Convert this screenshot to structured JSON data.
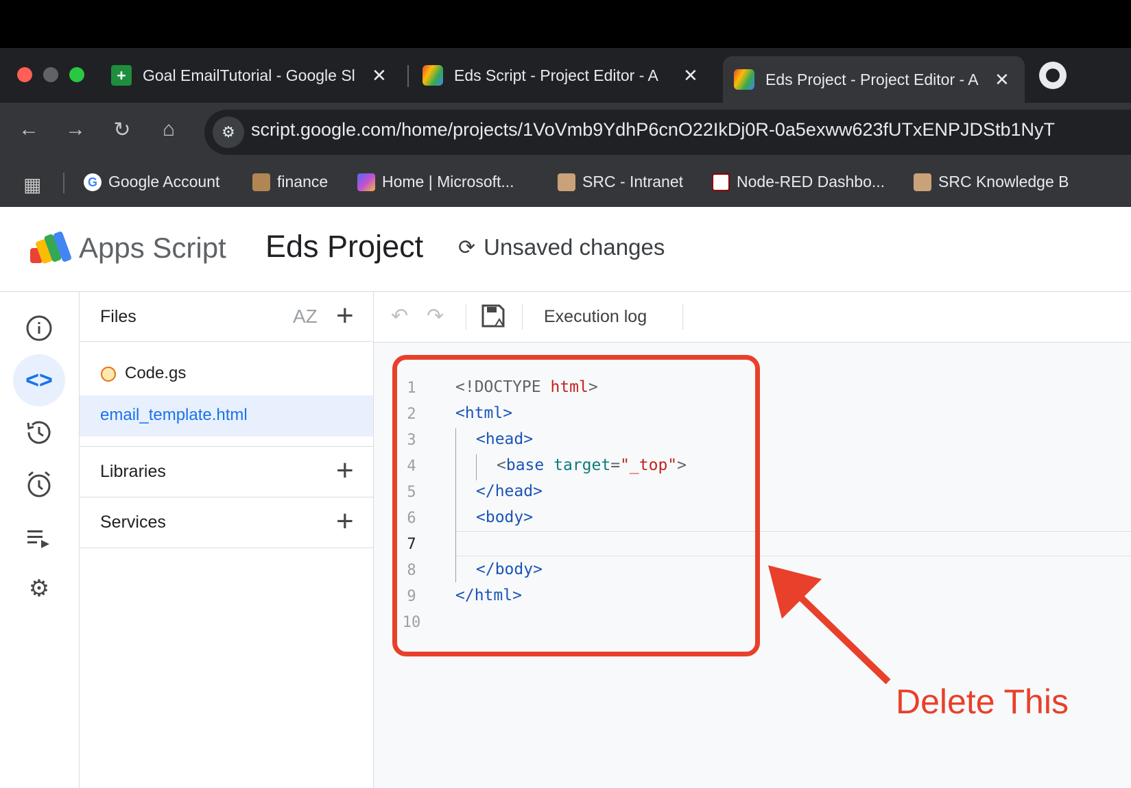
{
  "browser": {
    "tabs": [
      {
        "title": "Goal EmailTutorial - Google Sl",
        "close": "✕"
      },
      {
        "title": "Eds Script - Project Editor - A",
        "close": "✕"
      },
      {
        "title": "Eds Project - Project Editor - A",
        "close": "✕"
      }
    ],
    "url": "script.google.com/home/projects/1VoVmb9YdhP6cnO22IkDj0R-0a5exww623fUTxENPJDStb1NyT",
    "bookmarks": [
      "Google Account",
      "finance",
      "Home | Microsoft...",
      "SRC - Intranet",
      "Node-RED Dashbo...",
      "SRC Knowledge B"
    ]
  },
  "app": {
    "name": "Apps Script",
    "project_title": "Eds Project",
    "save_status": "Unsaved changes"
  },
  "files_panel": {
    "files_label": "Files",
    "sort_label": "AZ",
    "files": [
      "Code.gs",
      "email_template.html"
    ],
    "libraries_label": "Libraries",
    "services_label": "Services"
  },
  "toolbar": {
    "execution_log_label": "Execution log"
  },
  "editor": {
    "line_numbers": [
      "1",
      "2",
      "3",
      "4",
      "5",
      "6",
      "7",
      "8",
      "9",
      "10"
    ],
    "lines": [
      "<!DOCTYPE html>",
      "<html>",
      "<head>",
      "<base target=\"_top\">",
      "</head>",
      "<body>",
      "",
      "</body>",
      "</html>",
      ""
    ]
  },
  "annotation": {
    "label": "Delete This",
    "color": "#e8402a"
  },
  "colors": {
    "accent": "#1a73e8",
    "selected_bg": "#e8f0fe",
    "annotation_red": "#e8402a"
  }
}
